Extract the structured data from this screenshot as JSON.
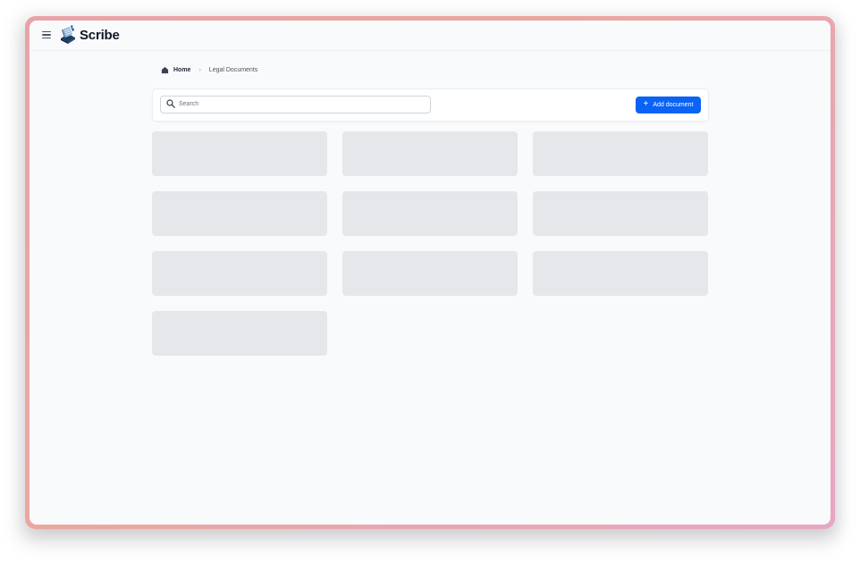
{
  "app": {
    "name": "Scribe",
    "accent_color": "#0a63f4"
  },
  "topbar": {
    "menu_icon": "hamburger-menu-icon",
    "logo_icon": "notebook-logo-icon"
  },
  "breadcrumb": {
    "home_label": "Home",
    "home_icon": "home-icon",
    "separator": "›",
    "current_label": "Legal Documents"
  },
  "toolbar": {
    "search_placeholder": "Search",
    "search_value": "",
    "add_button_label": "Add document",
    "add_button_icon": "plus-icon"
  },
  "documents": {
    "loading": true,
    "placeholder_cards": 10
  }
}
